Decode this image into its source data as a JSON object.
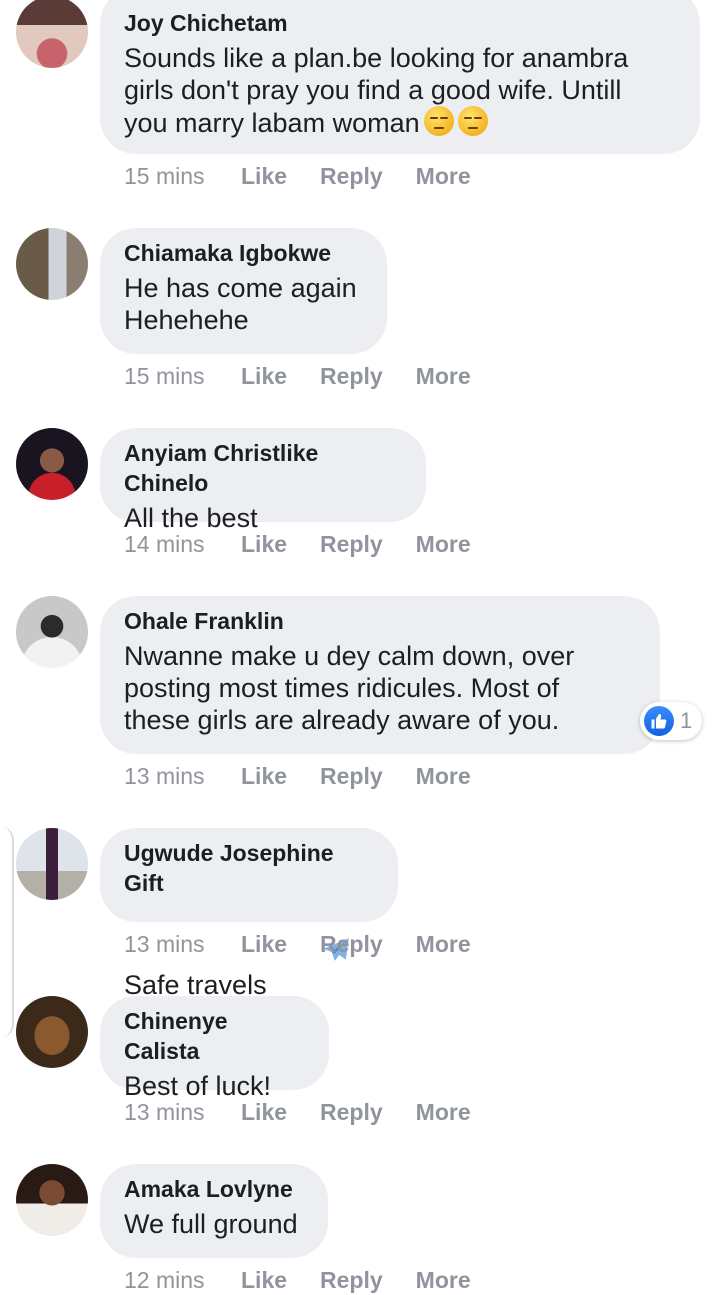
{
  "actions": {
    "like": "Like",
    "reply": "Reply",
    "more": "More"
  },
  "comments": [
    {
      "name": "Joy Chichetam",
      "text": "Sounds like a plan.be looking for anambra\ngirls don't pray you find a good wife. Untill\nyou marry labam woman",
      "emoji": "unamused-face-emoji x2",
      "time": "15 mins"
    },
    {
      "name": "Chiamaka Igbokwe",
      "text": "He has come again\nHehehehe",
      "time": "15 mins"
    },
    {
      "name": "Anyiam Christlike Chinelo",
      "text": "All the best",
      "time": "14 mins"
    },
    {
      "name": "Ohale Franklin",
      "text": "Nwanne make u dey calm down, over\nposting most times ridicules. Most of\nthese girls are already aware of you.",
      "time": "13 mins",
      "reaction_count": "1"
    },
    {
      "name": "Ugwude Josephine Gift",
      "text": "Safe travels",
      "emoji": "airplane-emoji",
      "time": "13 mins"
    },
    {
      "name": "Chinenye Calista",
      "text": "Best of luck!",
      "time": "13 mins"
    },
    {
      "name": "Amaka Lovlyne",
      "text": "We full ground",
      "time": "12 mins"
    }
  ]
}
